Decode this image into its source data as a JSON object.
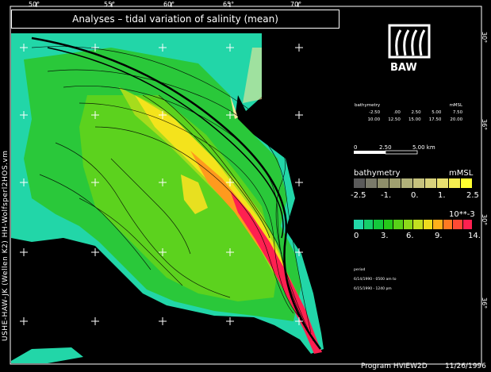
{
  "title": "Analyses  –  tidal variation of salinity (mean)",
  "top_ticks": [
    "50°",
    "55°",
    "60°",
    "65°",
    "70°"
  ],
  "side_text": "USHE-HAW-JK (Wellen K2) HH-Wolfsperl2HOS.vm",
  "right_ticks": [
    "30°",
    "36°",
    "30°",
    "36°"
  ],
  "logo_text": "BAW",
  "bathymetry_table": {
    "header": [
      "bathymetry",
      "",
      "",
      "",
      "mMSL"
    ],
    "row1": [
      "-2.50",
      ".00",
      "2.50",
      "5.00",
      "7.50"
    ],
    "row2": [
      "10.00",
      "12.50",
      "15.00",
      "17.50",
      "20.00"
    ]
  },
  "scale": {
    "labels": [
      "0",
      "2.50",
      "5.00 km"
    ]
  },
  "bath_legend": {
    "title": "bathymetry",
    "unit": "mMSL",
    "labels": [
      "-2.5",
      "-1.",
      "0.",
      "1.",
      "2.5"
    ],
    "colors": [
      "#5a5a5a",
      "#7a7a6a",
      "#8e8e6a",
      "#a0a070",
      "#b2b27a",
      "#c6c27e",
      "#d8d27c",
      "#e8e070",
      "#f6ee50",
      "#ffff30"
    ]
  },
  "sal_legend": {
    "unit": "10**-3",
    "labels": [
      "0",
      "3.",
      "6.",
      "9.",
      "14."
    ],
    "colors": [
      "#22d6a8",
      "#16ce6a",
      "#14c83c",
      "#26c81a",
      "#58d018",
      "#8cd81a",
      "#c2e020",
      "#eedc1e",
      "#ffb01a",
      "#ff7a22",
      "#ff4a34",
      "#ff2050"
    ]
  },
  "notes": [
    "period",
    "6/14/1990 - 0500 am to",
    "6/15/1990 - 1240 pm"
  ],
  "footer": {
    "program": "Program  HVIEW2D",
    "date": "11/26/1996"
  },
  "colors": {
    "water_cyan": "#22d6a8",
    "green": "#2ac83a",
    "yellow": "#f4e31c",
    "red": "#ff2050",
    "land": "#000000",
    "shore": "#f4e89a"
  }
}
